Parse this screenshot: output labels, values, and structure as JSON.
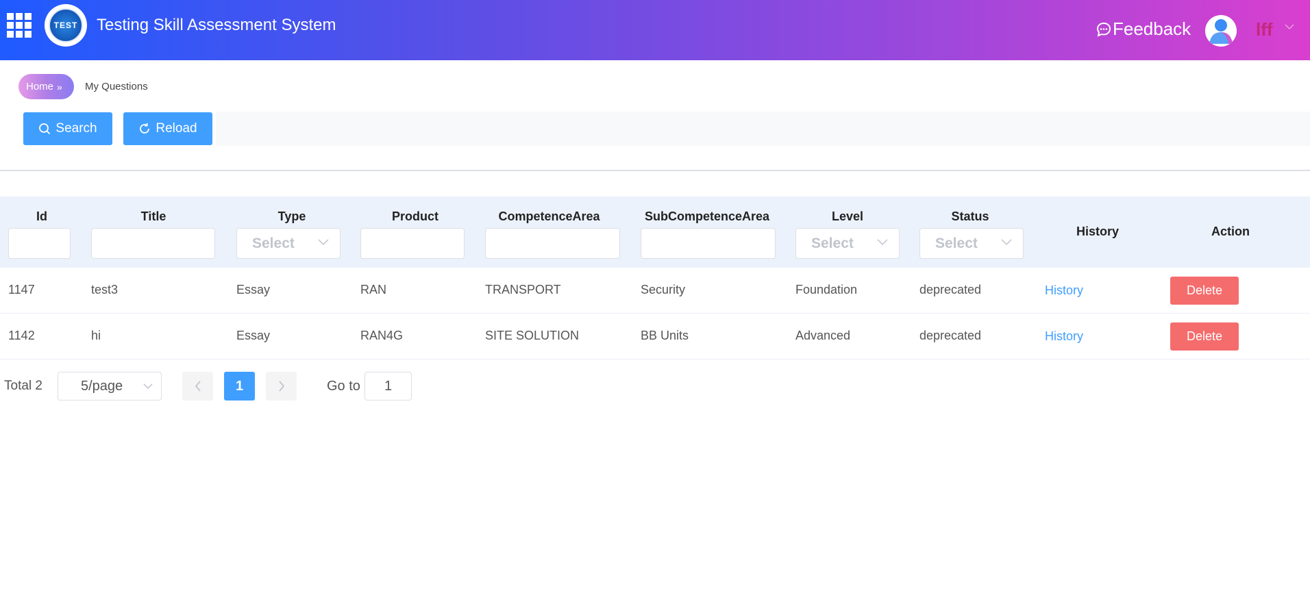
{
  "header": {
    "app_title": "Testing Skill Assessment System",
    "logo_text": "TEST",
    "feedback_label": "Feedback",
    "username": "lff",
    "gradient_start": "#1f5bff",
    "gradient_end": "#d93fcf"
  },
  "breadcrumb": {
    "home": "Home",
    "current": "My Questions"
  },
  "toolbar": {
    "search_label": "Search",
    "reload_label": "Reload"
  },
  "table": {
    "columns": {
      "id": "Id",
      "title": "Title",
      "type": "Type",
      "product": "Product",
      "competence_area": "CompetenceArea",
      "sub_competence_area": "SubCompetenceArea",
      "level": "Level",
      "status": "Status",
      "history": "History",
      "action": "Action"
    },
    "filters": {
      "type_placeholder": "Select",
      "level_placeholder": "Select",
      "status_placeholder": "Select"
    },
    "rows": [
      {
        "id": "1147",
        "title": "test3",
        "type": "Essay",
        "product": "RAN",
        "competence_area": "TRANSPORT",
        "sub_competence_area": "Security",
        "level": "Foundation",
        "status": "deprecated",
        "history_link": "History",
        "action_label": "Delete"
      },
      {
        "id": "1142",
        "title": "hi",
        "type": "Essay",
        "product": "RAN4G",
        "competence_area": "SITE SOLUTION",
        "sub_competence_area": "BB Units",
        "level": "Advanced",
        "status": "deprecated",
        "history_link": "History",
        "action_label": "Delete"
      }
    ]
  },
  "pagination": {
    "total_label": "Total 2",
    "page_size": "5/page",
    "current_page": "1",
    "goto_label": "Go to",
    "goto_value": "1"
  },
  "colors": {
    "primary": "#409eff",
    "danger": "#f56c6c",
    "table_header_bg": "#ecf2fc"
  }
}
